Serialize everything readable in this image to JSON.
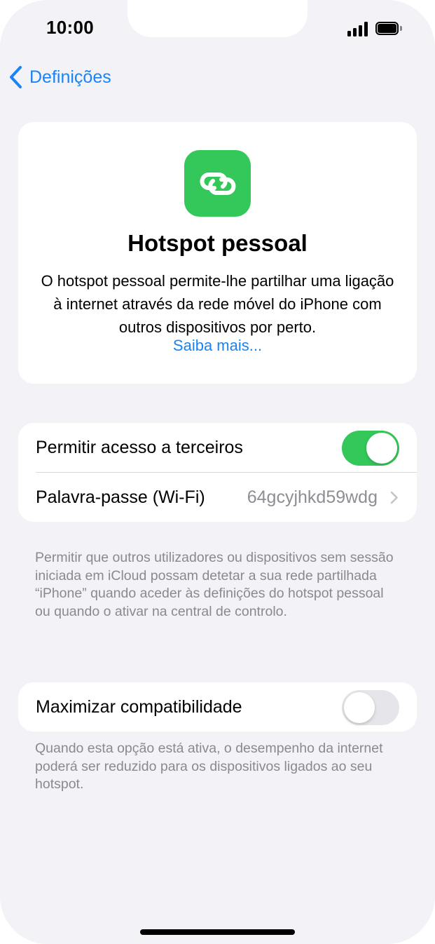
{
  "status_bar": {
    "time": "10:00",
    "signal_icon": "cellular-signal-icon",
    "battery_icon": "battery-full-icon"
  },
  "nav": {
    "back_label": "Definições",
    "back_icon": "chevron-left-icon"
  },
  "hero": {
    "icon": "hotspot-link-icon",
    "icon_color": "#34c759",
    "title": "Hotspot pessoal",
    "description": "O hotspot pessoal permite-lhe partilhar uma ligação à internet através da rede móvel do iPhone com outros dispositivos por perto.",
    "link": "Saiba mais..."
  },
  "settings": {
    "allow_others": {
      "label": "Permitir acesso a terceiros",
      "enabled": true
    },
    "wifi_password": {
      "label": "Palavra-passe (Wi-Fi)",
      "value": "64gcyjhkd59wdg"
    },
    "allow_others_footnote": "Permitir que outros utilizadores ou dispositivos sem sessão iniciada em iCloud possam detetar a sua rede partilhada “iPhone” quando aceder às definições do hotspot pessoal ou quando o ativar na central de controlo.",
    "maximize_compat": {
      "label": "Maximizar compatibilidade",
      "enabled": false
    },
    "maximize_compat_footnote": "Quando esta opção está ativa, o desempenho da internet poderá ser reduzido para os dispositivos ligados ao seu hotspot."
  },
  "colors": {
    "accent": "#007aff",
    "toggle_on": "#34c759",
    "toggle_off": "#e5e5ea",
    "background": "#f2f2f7"
  }
}
